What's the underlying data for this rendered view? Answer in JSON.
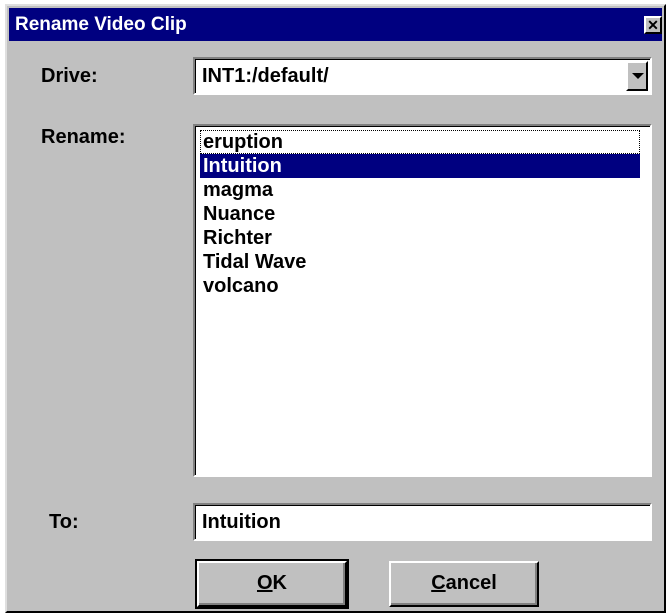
{
  "window": {
    "title": "Rename Video Clip",
    "close_glyph": "✕"
  },
  "drive": {
    "label": "Drive:",
    "value": "INT1:/default/"
  },
  "rename": {
    "label": "Rename:",
    "items": [
      "eruption",
      "Intuition",
      "magma",
      "Nuance",
      "Richter",
      "Tidal Wave",
      "volcano"
    ],
    "selected": "Intuition"
  },
  "to": {
    "label": "To:",
    "value": "Intuition"
  },
  "buttons": {
    "ok": {
      "accel": "O",
      "rest": "K"
    },
    "cancel": {
      "accel": "C",
      "rest": "ancel"
    }
  },
  "colors": {
    "title_bar": "#000080",
    "selection": "#000080",
    "dialog_face": "#c0c0c0"
  }
}
